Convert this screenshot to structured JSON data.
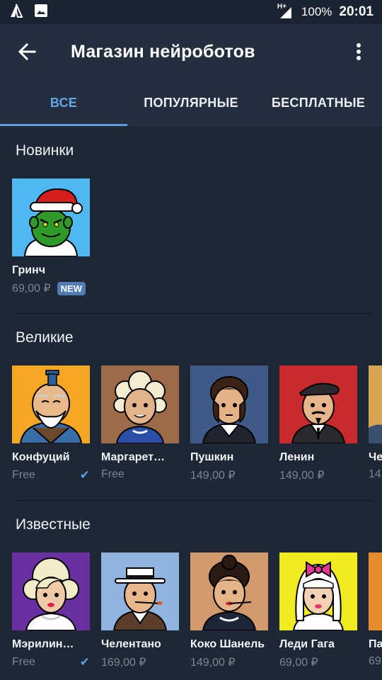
{
  "status_bar": {
    "network": "H+",
    "battery": "100%",
    "time": "20:01"
  },
  "app_bar": {
    "title": "Магазин нейроботов"
  },
  "tabs": [
    {
      "label": "ВСЕ",
      "active": true
    },
    {
      "label": "ПОПУЛЯРНЫЕ",
      "active": false
    },
    {
      "label": "БЕСПЛАТНЫЕ",
      "active": false
    }
  ],
  "sections": [
    {
      "title": "Новинки",
      "items": [
        {
          "name": "Гринч",
          "price": "69,00 ₽",
          "badge": "NEW"
        }
      ]
    },
    {
      "title": "Великие",
      "items": [
        {
          "name": "Конфуций",
          "price": "Free",
          "owned": true
        },
        {
          "name": "Маргарет…",
          "price": "Free"
        },
        {
          "name": "Пушкин",
          "price": "149,00 ₽"
        },
        {
          "name": "Ленин",
          "price": "149,00 ₽"
        },
        {
          "name": "Че",
          "price": "14"
        }
      ]
    },
    {
      "title": "Известные",
      "items": [
        {
          "name": "Мэрилин…",
          "price": "Free",
          "owned": true
        },
        {
          "name": "Челентано",
          "price": "169,00 ₽"
        },
        {
          "name": "Коко Шанель",
          "price": "149,00 ₽"
        },
        {
          "name": "Леди Гага",
          "price": "69,00 ₽"
        },
        {
          "name": "Па",
          "price": "69"
        }
      ]
    }
  ],
  "colors": {
    "background": "#1d2735",
    "app_bar": "#232f3f",
    "accent": "#5d9fe0",
    "badge": "#4f7db2",
    "muted_text": "#7b8592"
  },
  "icons": {
    "back": "arrow-left-icon",
    "menu": "more-vert-icon",
    "owned": "checkmark-icon"
  }
}
